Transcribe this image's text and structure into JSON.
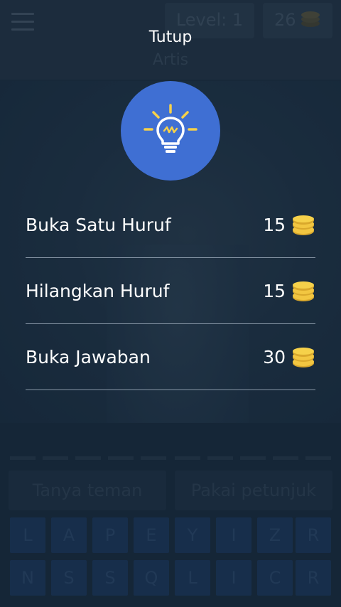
{
  "header": {
    "level_label": "Level: 1",
    "coins": "26",
    "category": "Artis"
  },
  "answer_slots": 10,
  "help_buttons": {
    "ask_friend": "Tanya teman",
    "use_hint": "Pakai petunjuk"
  },
  "keyboard": {
    "row1": [
      "L",
      "A",
      "P",
      "E",
      "Y",
      "I",
      "Z",
      "R"
    ],
    "row2": [
      "N",
      "S",
      "S",
      "Q",
      "L",
      "I",
      "C",
      "R"
    ]
  },
  "dialog": {
    "close_label": "Tutup",
    "icon": "lightbulb-icon",
    "options": [
      {
        "label": "Buka Satu Huruf",
        "price": "15"
      },
      {
        "label": "Hilangkan Huruf",
        "price": "15"
      },
      {
        "label": "Buka Jawaban",
        "price": "30"
      }
    ]
  },
  "colors": {
    "accent_circle": "#3f6fd3",
    "coin_gold": "#f2c641",
    "bulb_yellow": "#f6d14a"
  }
}
